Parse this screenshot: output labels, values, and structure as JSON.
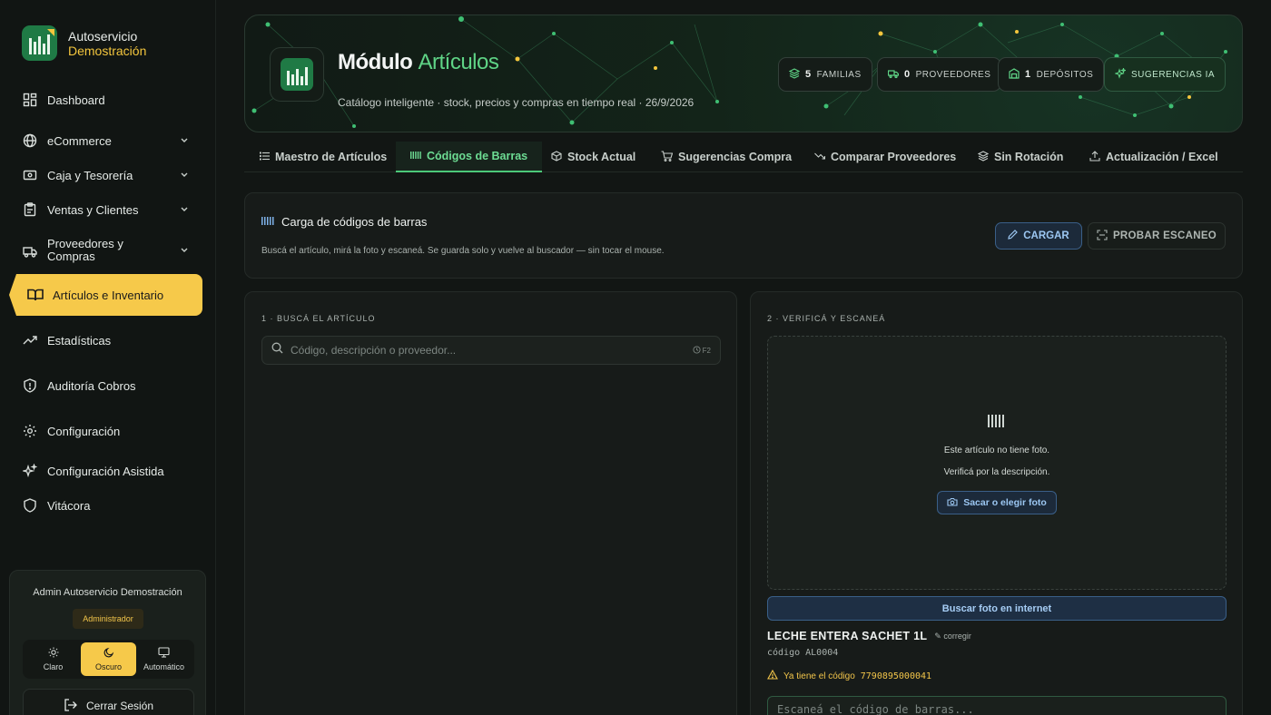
{
  "brand": {
    "name": "Autoservicio",
    "subtitle": "Demostración"
  },
  "sidebar": {
    "items": [
      {
        "label": "Dashboard",
        "icon": "dashboard-icon"
      },
      {
        "label": "eCommerce",
        "icon": "globe-icon",
        "expandable": true
      },
      {
        "label": "Caja y Tesorería",
        "icon": "cash-icon",
        "expandable": true
      },
      {
        "label": "Ventas y Clientes",
        "icon": "clipboard-icon",
        "expandable": true
      },
      {
        "label": "Proveedores y",
        "label2": "Compras",
        "icon": "truck-icon",
        "expandable": true
      },
      {
        "label": "Artículos e Inventario",
        "icon": "book-icon",
        "active": true
      },
      {
        "label": "Estadísticas",
        "icon": "trend-icon"
      },
      {
        "label": "Auditoría Cobros",
        "icon": "shield-alert-icon"
      },
      {
        "label": "Configuración",
        "icon": "gear-icon"
      },
      {
        "label": "Configuración Asistida",
        "icon": "sparkles-icon"
      },
      {
        "label": "Vitácora",
        "icon": "shield-icon"
      }
    ]
  },
  "user": {
    "name": "Admin Autoservicio Demostración",
    "role": "Administrador",
    "themes": [
      "Claro",
      "Oscuro",
      "Automático"
    ],
    "selected_theme": "Oscuro",
    "logout": "Cerrar Sesión"
  },
  "hero": {
    "title_1": "Módulo",
    "title_2": "Artículos",
    "subtitle": "Catálogo inteligente · stock, precios y compras en tiempo real · 26/9/2026",
    "chips": [
      {
        "count": "5",
        "label": "FAMILIAS",
        "icon": "layers-icon"
      },
      {
        "count": "0",
        "label": "PROVEEDORES",
        "icon": "truck-icon"
      },
      {
        "count": "1",
        "label": "DEPÓSITOS",
        "icon": "warehouse-icon"
      },
      {
        "count": "",
        "label": "SUGERENCIAS IA",
        "icon": "sparkles-icon"
      }
    ]
  },
  "tabs": [
    {
      "label": "Maestro de Artículos",
      "icon": "list-icon"
    },
    {
      "label": "Códigos de Barras",
      "icon": "barcode-icon",
      "active": true
    },
    {
      "label": "Stock Actual",
      "icon": "box-icon"
    },
    {
      "label": "Sugerencias Compra",
      "icon": "cart-icon"
    },
    {
      "label": "Comparar Proveedores",
      "icon": "trend-down-icon"
    },
    {
      "label": "Sin Rotación",
      "icon": "layers-icon"
    },
    {
      "label": "Actualización / Excel",
      "icon": "upload-icon"
    }
  ],
  "load": {
    "title": "Carga de códigos de barras",
    "description": "Buscá el artículo, mirá la foto y escaneá. Se guarda solo y vuelve al buscador — sin tocar el mouse.",
    "btn_cargar": "CARGAR",
    "btn_probar": "PROBAR ESCANEO"
  },
  "step1": {
    "label": "1 · BUSCÁ EL ARTÍCULO",
    "placeholder": "Código, descripción o proveedor...",
    "shortcut": "F2"
  },
  "step2": {
    "label": "2 · VERIFICÁ Y ESCANEÁ",
    "no_photo": "Este artículo no tiene foto.",
    "verify": "Verificá por la descripción.",
    "btn_foto": "Sacar o elegir foto",
    "btn_internet": "Buscar foto en internet",
    "product_name": "LECHE ENTERA SACHET 1L",
    "corregir": "corregir",
    "product_code": "código AL0004",
    "warning_prefix": "Ya tiene el código",
    "warning_code": "7790895000041",
    "scan_placeholder": "Escaneá el código de barras..."
  },
  "colors": {
    "accent_yellow": "#f6c94a",
    "accent_green": "#5fd486",
    "accent_blue": "#9cc7f2",
    "background": "#121614"
  }
}
